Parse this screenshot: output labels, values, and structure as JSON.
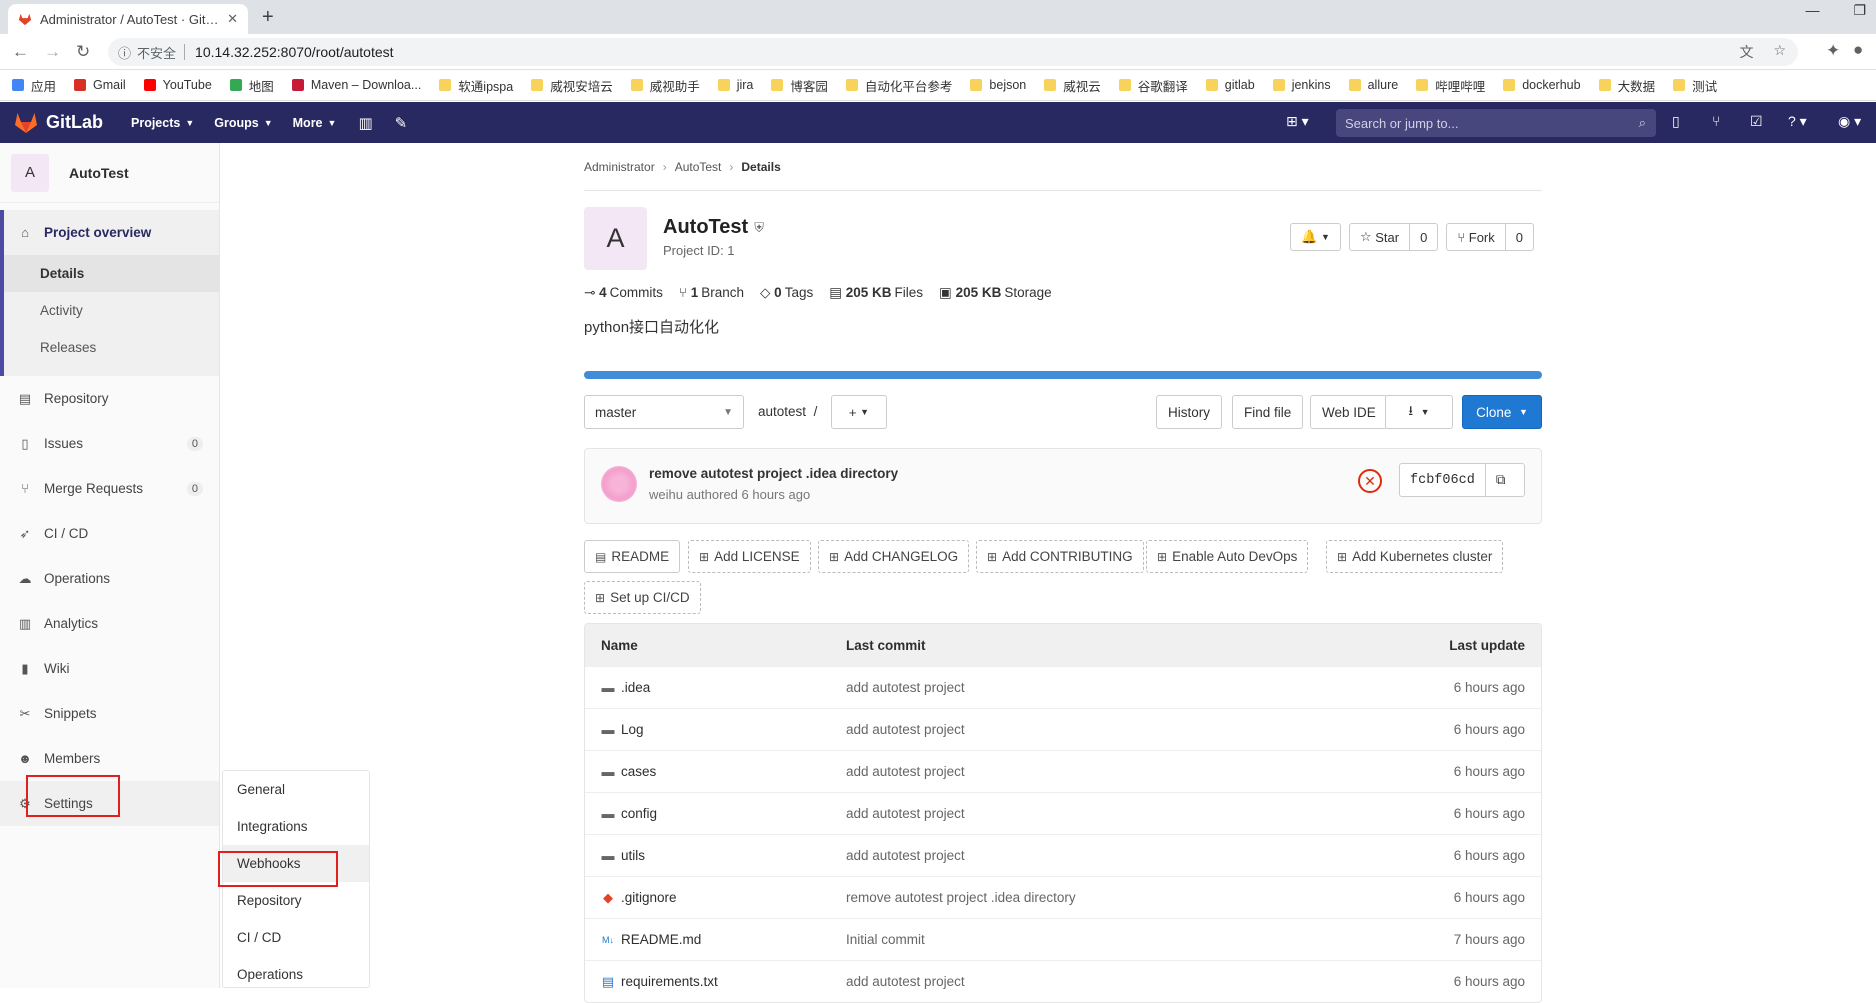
{
  "browser": {
    "tab_title": "Administrator / AutoTest · Git…",
    "new_tab": "+",
    "address_insecure": "不安全",
    "url": "10.14.32.252:8070/root/autotest",
    "bookmarks": [
      "应用",
      "Gmail",
      "YouTube",
      "地图",
      "Maven – Downloa...",
      "软通ipspa",
      "威视安培云",
      "威视助手",
      "jira",
      "博客园",
      "自动化平台参考",
      "bejson",
      "威视云",
      "谷歌翻译",
      "gitlab",
      "jenkins",
      "allure",
      "哔哩哔哩",
      "dockerhub",
      "大数据",
      "测试"
    ]
  },
  "gitlab_nav": {
    "brand": "GitLab",
    "projects": "Projects",
    "groups": "Groups",
    "more": "More",
    "search_placeholder": "Search or jump to..."
  },
  "sidebar": {
    "avatar_letter": "A",
    "project_name": "AutoTest",
    "overview": "Project overview",
    "overview_sub": [
      "Details",
      "Activity",
      "Releases"
    ],
    "items": [
      {
        "label": "Repository",
        "icon": "repository-icon"
      },
      {
        "label": "Issues",
        "icon": "issues-icon",
        "count": "0"
      },
      {
        "label": "Merge Requests",
        "icon": "merge-request-icon",
        "count": "0"
      },
      {
        "label": "CI / CD",
        "icon": "rocket-icon"
      },
      {
        "label": "Operations",
        "icon": "cloud-gear-icon"
      },
      {
        "label": "Analytics",
        "icon": "chart-icon"
      },
      {
        "label": "Wiki",
        "icon": "book-icon"
      },
      {
        "label": "Snippets",
        "icon": "scissors-icon"
      },
      {
        "label": "Members",
        "icon": "users-icon"
      }
    ],
    "settings": "Settings",
    "settings_flyout": [
      "General",
      "Integrations",
      "Webhooks",
      "Repository",
      "CI / CD",
      "Operations"
    ]
  },
  "breadcrumb": {
    "a": "Administrator",
    "b": "AutoTest",
    "c": "Details"
  },
  "project": {
    "avatar_letter": "A",
    "name": "AutoTest",
    "id": "Project ID: 1",
    "star_label": "Star",
    "star_count": "0",
    "fork_label": "Fork",
    "fork_count": "0",
    "stats": {
      "commits_n": "4",
      "commits_l": "Commits",
      "branch_n": "1",
      "branch_l": "Branch",
      "tags_n": "0",
      "tags_l": "Tags",
      "files_n": "205 KB",
      "files_l": "Files",
      "storage_n": "205 KB",
      "storage_l": "Storage"
    },
    "description": "python接口自动化化"
  },
  "toolbar": {
    "branch": "master",
    "path": "autotest",
    "path_sep": "/",
    "history": "History",
    "find_file": "Find file",
    "web_ide": "Web IDE",
    "clone": "Clone"
  },
  "last_commit": {
    "message": "remove autotest project .idea directory",
    "author_line": "weihu authored 6 hours ago",
    "sha": "fcbf06cd"
  },
  "quick_buttons": [
    "README",
    "Add LICENSE",
    "Add CHANGELOG",
    "Add CONTRIBUTING",
    "Enable Auto DevOps",
    "Add Kubernetes cluster",
    "Set up CI/CD"
  ],
  "files": {
    "headers": {
      "name": "Name",
      "commit": "Last commit",
      "update": "Last update"
    },
    "rows": [
      {
        "icon": "folder-icon",
        "name": ".idea",
        "commit": "add autotest project",
        "update": "6 hours ago"
      },
      {
        "icon": "folder-icon",
        "name": "Log",
        "commit": "add autotest project",
        "update": "6 hours ago"
      },
      {
        "icon": "folder-icon",
        "name": "cases",
        "commit": "add autotest project",
        "update": "6 hours ago"
      },
      {
        "icon": "folder-icon",
        "name": "config",
        "commit": "add autotest project",
        "update": "6 hours ago"
      },
      {
        "icon": "folder-icon",
        "name": "utils",
        "commit": "add autotest project",
        "update": "6 hours ago"
      },
      {
        "icon": "git-icon",
        "name": ".gitignore",
        "commit": "remove autotest project .idea directory",
        "update": "6 hours ago"
      },
      {
        "icon": "markdown-icon",
        "name": "README.md",
        "commit": "Initial commit",
        "update": "7 hours ago"
      },
      {
        "icon": "file-icon",
        "name": "requirements.txt",
        "commit": "add autotest project",
        "update": "6 hours ago"
      }
    ]
  },
  "colors": {
    "nav": "#292961",
    "accent": "#1f78d1",
    "highlight": "#e02020"
  }
}
